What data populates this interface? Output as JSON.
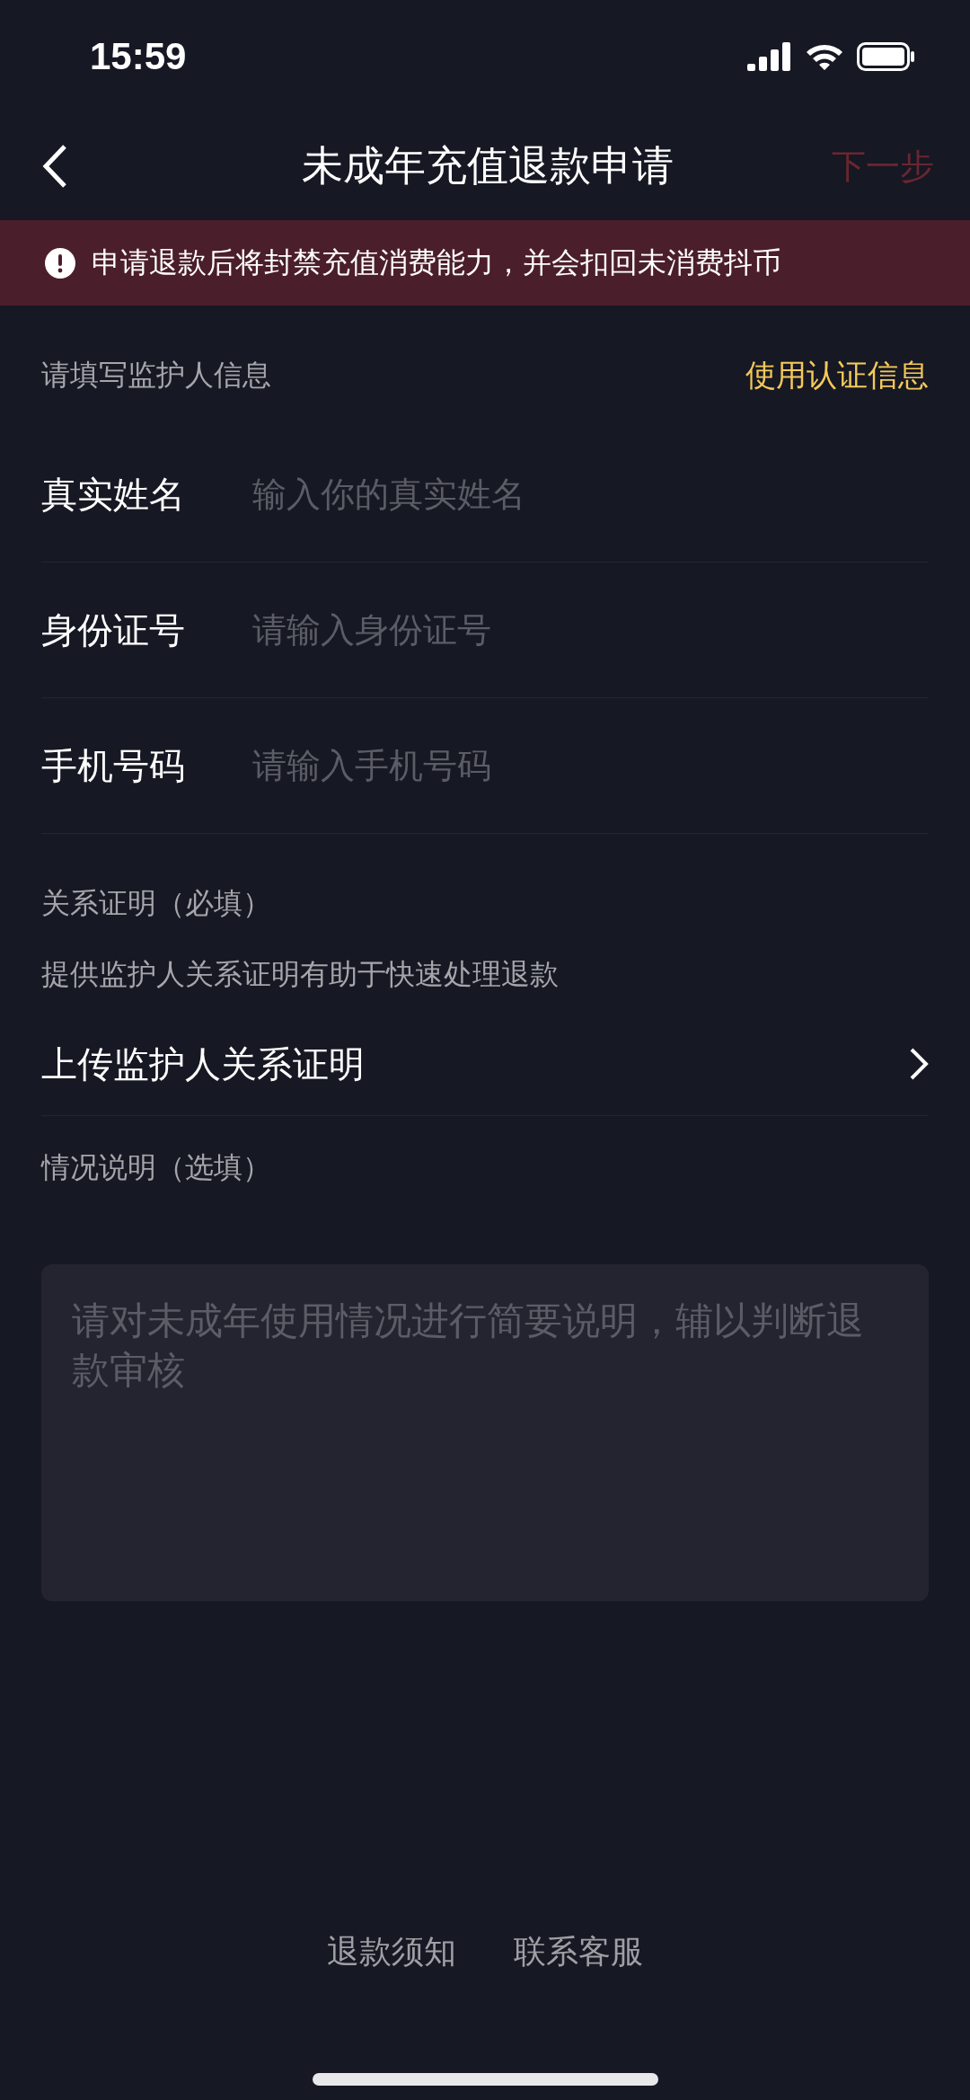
{
  "status_bar": {
    "time": "15:59"
  },
  "nav": {
    "title": "未成年充值退款申请",
    "next": {
      "label": "下一步",
      "disabled": true
    }
  },
  "notice": {
    "text": "申请退款后将封禁充值消费能力，并会扣回未消费抖币"
  },
  "guardian": {
    "heading": "请填写监护人信息",
    "action": "使用认证信息",
    "fields": [
      {
        "label": "真实姓名",
        "placeholder": "输入你的真实姓名"
      },
      {
        "label": "身份证号",
        "placeholder": "请输入身份证号"
      },
      {
        "label": "手机号码",
        "placeholder": "请输入手机号码"
      }
    ]
  },
  "proof": {
    "heading": "关系证明（必填）",
    "hint": "提供监护人关系证明有助于快速处理退款",
    "upload": "上传监护人关系证明"
  },
  "description": {
    "heading": "情况说明（选填）",
    "placeholder": "请对未成年使用情况进行简要说明，辅以判断退款审核"
  },
  "footer": [
    "退款须知",
    "联系客服"
  ]
}
